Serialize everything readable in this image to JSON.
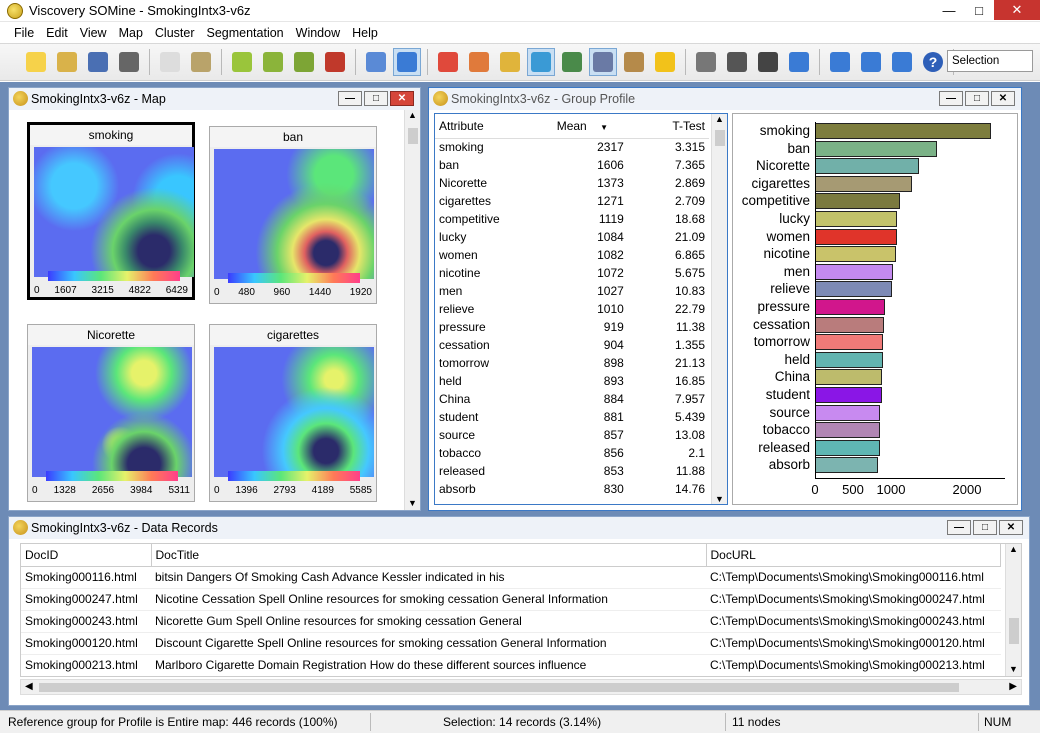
{
  "app": {
    "title": "Viscovery SOMine - SmokingIntx3-v6z"
  },
  "menu": [
    "File",
    "Edit",
    "View",
    "Map",
    "Cluster",
    "Segmentation",
    "Window",
    "Help"
  ],
  "toolbar": {
    "icons": [
      "new-icon",
      "open-icon",
      "save-icon",
      "print-icon",
      "copy-icon",
      "paste-icon",
      "hex-map-icon",
      "hex-map-icon",
      "hex-map-icon",
      "pin-icon",
      "cluster-flag-icon",
      "map-view-icon",
      "component-view-icon",
      "chart-icon",
      "pie-chart-icon",
      "profile-icon",
      "histogram-icon",
      "database-icon",
      "book-icon",
      "star-icon",
      "star-icon",
      "nodes-add-icon",
      "nodes-remove-icon",
      "zoom-fit-icon",
      "zoom-out-icon",
      "zoom-in-icon",
      "zoom-area-icon",
      "help-icon"
    ],
    "selection_combo": "Selection"
  },
  "map_window": {
    "title": "SmokingIntx3-v6z - Map",
    "cells": [
      {
        "label": "smoking",
        "ticks": [
          "0",
          "1607",
          "3215",
          "4822",
          "6429"
        ]
      },
      {
        "label": "ban",
        "ticks": [
          "0",
          "480",
          "960",
          "1440",
          "1920"
        ]
      },
      {
        "label": "Nicorette",
        "ticks": [
          "0",
          "1328",
          "2656",
          "3984",
          "5311"
        ]
      },
      {
        "label": "cigarettes",
        "ticks": [
          "0",
          "1396",
          "2793",
          "4189",
          "5585"
        ]
      }
    ]
  },
  "profile_window": {
    "title": "SmokingIntx3-v6z - Group Profile",
    "columns": {
      "attr": "Attribute",
      "mean": "Mean",
      "ttest": "T-Test"
    },
    "rows": [
      [
        "smoking",
        "2317",
        "3.315"
      ],
      [
        "ban",
        "1606",
        "7.365"
      ],
      [
        "Nicorette",
        "1373",
        "2.869"
      ],
      [
        "cigarettes",
        "1271",
        "2.709"
      ],
      [
        "competitive",
        "1119",
        "18.68"
      ],
      [
        "lucky",
        "1084",
        "21.09"
      ],
      [
        "women",
        "1082",
        "6.865"
      ],
      [
        "nicotine",
        "1072",
        "5.675"
      ],
      [
        "men",
        "1027",
        "10.83"
      ],
      [
        "relieve",
        "1010",
        "22.79"
      ],
      [
        "pressure",
        "919",
        "11.38"
      ],
      [
        "cessation",
        "904",
        "1.355"
      ],
      [
        "tomorrow",
        "898",
        "21.13"
      ],
      [
        "held",
        "893",
        "16.85"
      ],
      [
        "China",
        "884",
        "7.957"
      ],
      [
        "student",
        "881",
        "5.439"
      ],
      [
        "source",
        "857",
        "13.08"
      ],
      [
        "tobacco",
        "856",
        "2.1"
      ],
      [
        "released",
        "853",
        "11.88"
      ],
      [
        "absorb",
        "830",
        "14.76"
      ]
    ],
    "chart": {
      "bars": [
        {
          "label": "smoking",
          "value": 2317,
          "color": "#7d7d3e"
        },
        {
          "label": "ban",
          "value": 1606,
          "color": "#7bb287"
        },
        {
          "label": "Nicorette",
          "value": 1373,
          "color": "#71b0a9"
        },
        {
          "label": "cigarettes",
          "value": 1271,
          "color": "#a69a73"
        },
        {
          "label": "competitive",
          "value": 1119,
          "color": "#7b7a3f"
        },
        {
          "label": "lucky",
          "value": 1084,
          "color": "#c2c26a"
        },
        {
          "label": "women",
          "value": 1082,
          "color": "#e0342a"
        },
        {
          "label": "nicotine",
          "value": 1072,
          "color": "#c9c36a"
        },
        {
          "label": "men",
          "value": 1027,
          "color": "#c48af0"
        },
        {
          "label": "relieve",
          "value": 1010,
          "color": "#7d8ab5"
        },
        {
          "label": "pressure",
          "value": 919,
          "color": "#d1168c"
        },
        {
          "label": "cessation",
          "value": 904,
          "color": "#b97c7c"
        },
        {
          "label": "tomorrow",
          "value": 898,
          "color": "#f07a78"
        },
        {
          "label": "held",
          "value": 893,
          "color": "#62b4b0"
        },
        {
          "label": "China",
          "value": 884,
          "color": "#bdbb6c"
        },
        {
          "label": "student",
          "value": 881,
          "color": "#8a16e6"
        },
        {
          "label": "source",
          "value": 857,
          "color": "#c88af0"
        },
        {
          "label": "tobacco",
          "value": 856,
          "color": "#b186b4"
        },
        {
          "label": "released",
          "value": 853,
          "color": "#5fb6b3"
        },
        {
          "label": "absorb",
          "value": 830,
          "color": "#7cb4b0"
        }
      ],
      "axis_ticks": [
        {
          "label": "0",
          "value": 0
        },
        {
          "label": "500",
          "value": 500
        },
        {
          "label": "1000",
          "value": 1000
        },
        {
          "label": "2000",
          "value": 2000
        }
      ],
      "xmax": 2500
    }
  },
  "records_window": {
    "title": "SmokingIntx3-v6z - Data Records",
    "columns": [
      "DocID",
      "DocTitle",
      "DocURL"
    ],
    "rows": [
      [
        "Smoking000116.html",
        "bitsin Dangers Of Smoking Cash Advance Kessler indicated in his",
        "C:\\Temp\\Documents\\Smoking\\Smoking000116.html"
      ],
      [
        "Smoking000247.html",
        "Nicotine Cessation Spell Online resources for smoking cessation General Information",
        "C:\\Temp\\Documents\\Smoking\\Smoking000247.html"
      ],
      [
        "Smoking000243.html",
        "Nicorette Gum  Spell Online resources for smoking cessation General",
        "C:\\Temp\\Documents\\Smoking\\Smoking000243.html"
      ],
      [
        "Smoking000120.html",
        "Discount Cigarette Spell Online resources for smoking cessation General Information",
        "C:\\Temp\\Documents\\Smoking\\Smoking000120.html"
      ],
      [
        "Smoking000213.html",
        "Marlboro Cigarette Domain Registration How do these different sources influence",
        "C:\\Temp\\Documents\\Smoking\\Smoking000213.html"
      ]
    ]
  },
  "status": {
    "reference": "Reference group for Profile is Entire map: 446 records (100%)",
    "selection": "Selection: 14 records (3.14%)",
    "nodes": "11 nodes",
    "num": "NUM"
  }
}
